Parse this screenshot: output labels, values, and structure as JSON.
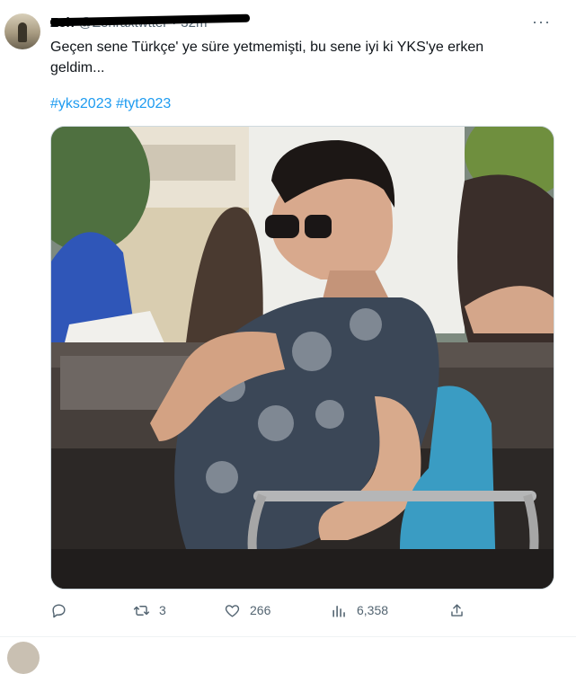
{
  "tweet": {
    "author_name": "Zeh",
    "author_handle": "@Zehraxtwtter",
    "timestamp": "32m",
    "more_label": "···",
    "text": "Geçen sene Türkçe' ye süre yetmemişti, bu sene iyi ki YKS'ye erken geldim...",
    "hashtags": "#yks2023 #tyt2023",
    "stats": {
      "replies": "",
      "retweets": "3",
      "likes": "266",
      "views": "6,358"
    }
  },
  "icons": [
    "reply-icon",
    "retweet-icon",
    "like-icon",
    "views-icon",
    "share-icon"
  ],
  "colors": {
    "link": "#1d9bf0",
    "muted": "#536471"
  }
}
